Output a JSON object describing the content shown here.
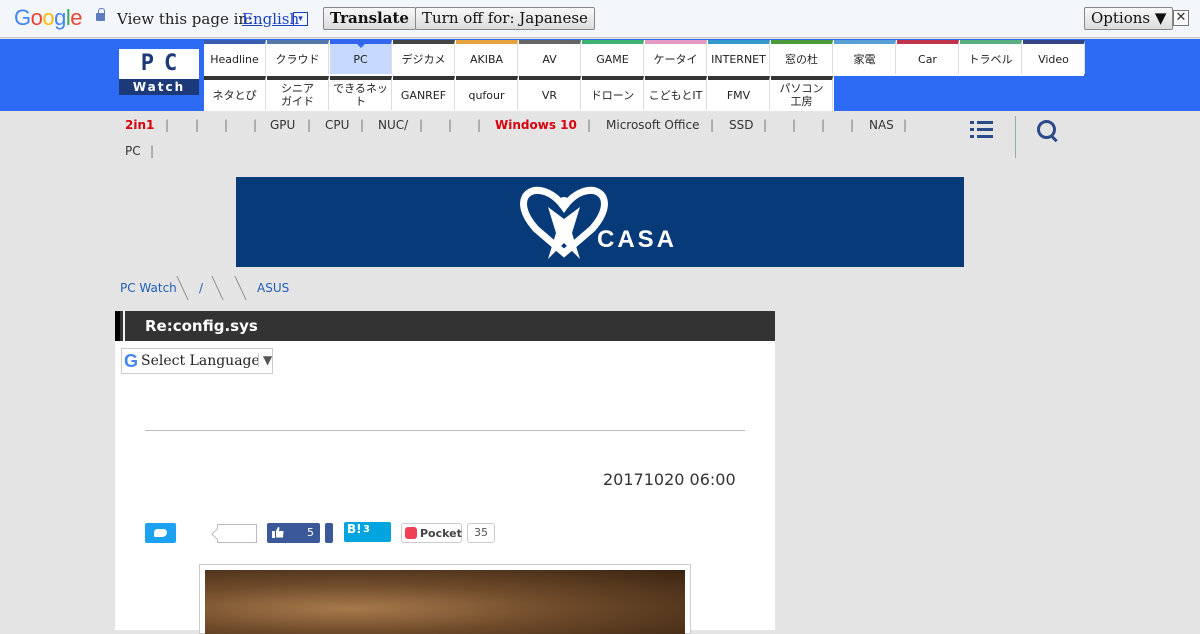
{
  "translate_bar": {
    "logo": "Google",
    "prompt": "View this page in:",
    "language": "English",
    "dropdown_glyph": "▾",
    "translate_button": "Translate",
    "turn_off_button": "Turn off for: Japanese",
    "options_button": "Options ▼",
    "close_glyph": "✕"
  },
  "site": {
    "logo_top": "PC",
    "logo_bottom": "Watch"
  },
  "nav": {
    "row1": [
      {
        "label": "Headline",
        "color": "#3a5fb0"
      },
      {
        "label": "クラウド",
        "color": "#5577aa"
      },
      {
        "label": "PC",
        "color": "#3366ee",
        "active": true
      },
      {
        "label": "デジカメ",
        "color": "#444444"
      },
      {
        "label": "AKIBA",
        "color": "#e6a23c"
      },
      {
        "label": "AV",
        "color": "#666666"
      },
      {
        "label": "GAME",
        "color": "#3cb371"
      },
      {
        "label": "ケータイ",
        "color": "#e39bc6"
      },
      {
        "label": "INTERNET",
        "color": "#3399cc"
      },
      {
        "label": "窓の杜",
        "color": "#4a9a3a"
      },
      {
        "label": "家電",
        "color": "#5aa0d8"
      },
      {
        "label": "Car",
        "color": "#c0334a"
      },
      {
        "label": "トラベル",
        "color": "#5ab080"
      },
      {
        "label": "Video",
        "color": "#334488"
      }
    ],
    "row2": [
      {
        "label": "ネタとぴ",
        "color": "#333333"
      },
      {
        "label": "シニア\nガイド",
        "color": "#333333"
      },
      {
        "label": "できるネット",
        "color": "#333333"
      },
      {
        "label": "GANREF",
        "color": "#333333"
      },
      {
        "label": "qufour",
        "color": "#333333"
      },
      {
        "label": "VR",
        "color": "#333333"
      },
      {
        "label": "ドローン",
        "color": "#333333"
      },
      {
        "label": "こどもとIT",
        "color": "#333333"
      },
      {
        "label": "FMV",
        "color": "#333333"
      },
      {
        "label": "パソコン\n工房",
        "color": "#333333"
      }
    ]
  },
  "topics": {
    "items": [
      "2in1",
      "GPU",
      "CPU",
      "NUC/",
      "Windows 10",
      "Microsoft Office",
      "SSD",
      "NAS",
      "PC"
    ],
    "separator": "|"
  },
  "banner": {
    "text": "CASA",
    "background": "#063a78"
  },
  "breadcrumb": {
    "home": "PC Watch",
    "slash": "/",
    "last": "ASUS"
  },
  "article": {
    "title": "Re:config.sys",
    "language_select": "Select Language",
    "language_select_arrow": "▼",
    "language_select_icon": "G",
    "date": "20171020 06:00",
    "facebook_count": "5",
    "hatena_label": "B!",
    "hatena_count": "3",
    "pocket_label": "Pocket",
    "pocket_count": "35"
  }
}
